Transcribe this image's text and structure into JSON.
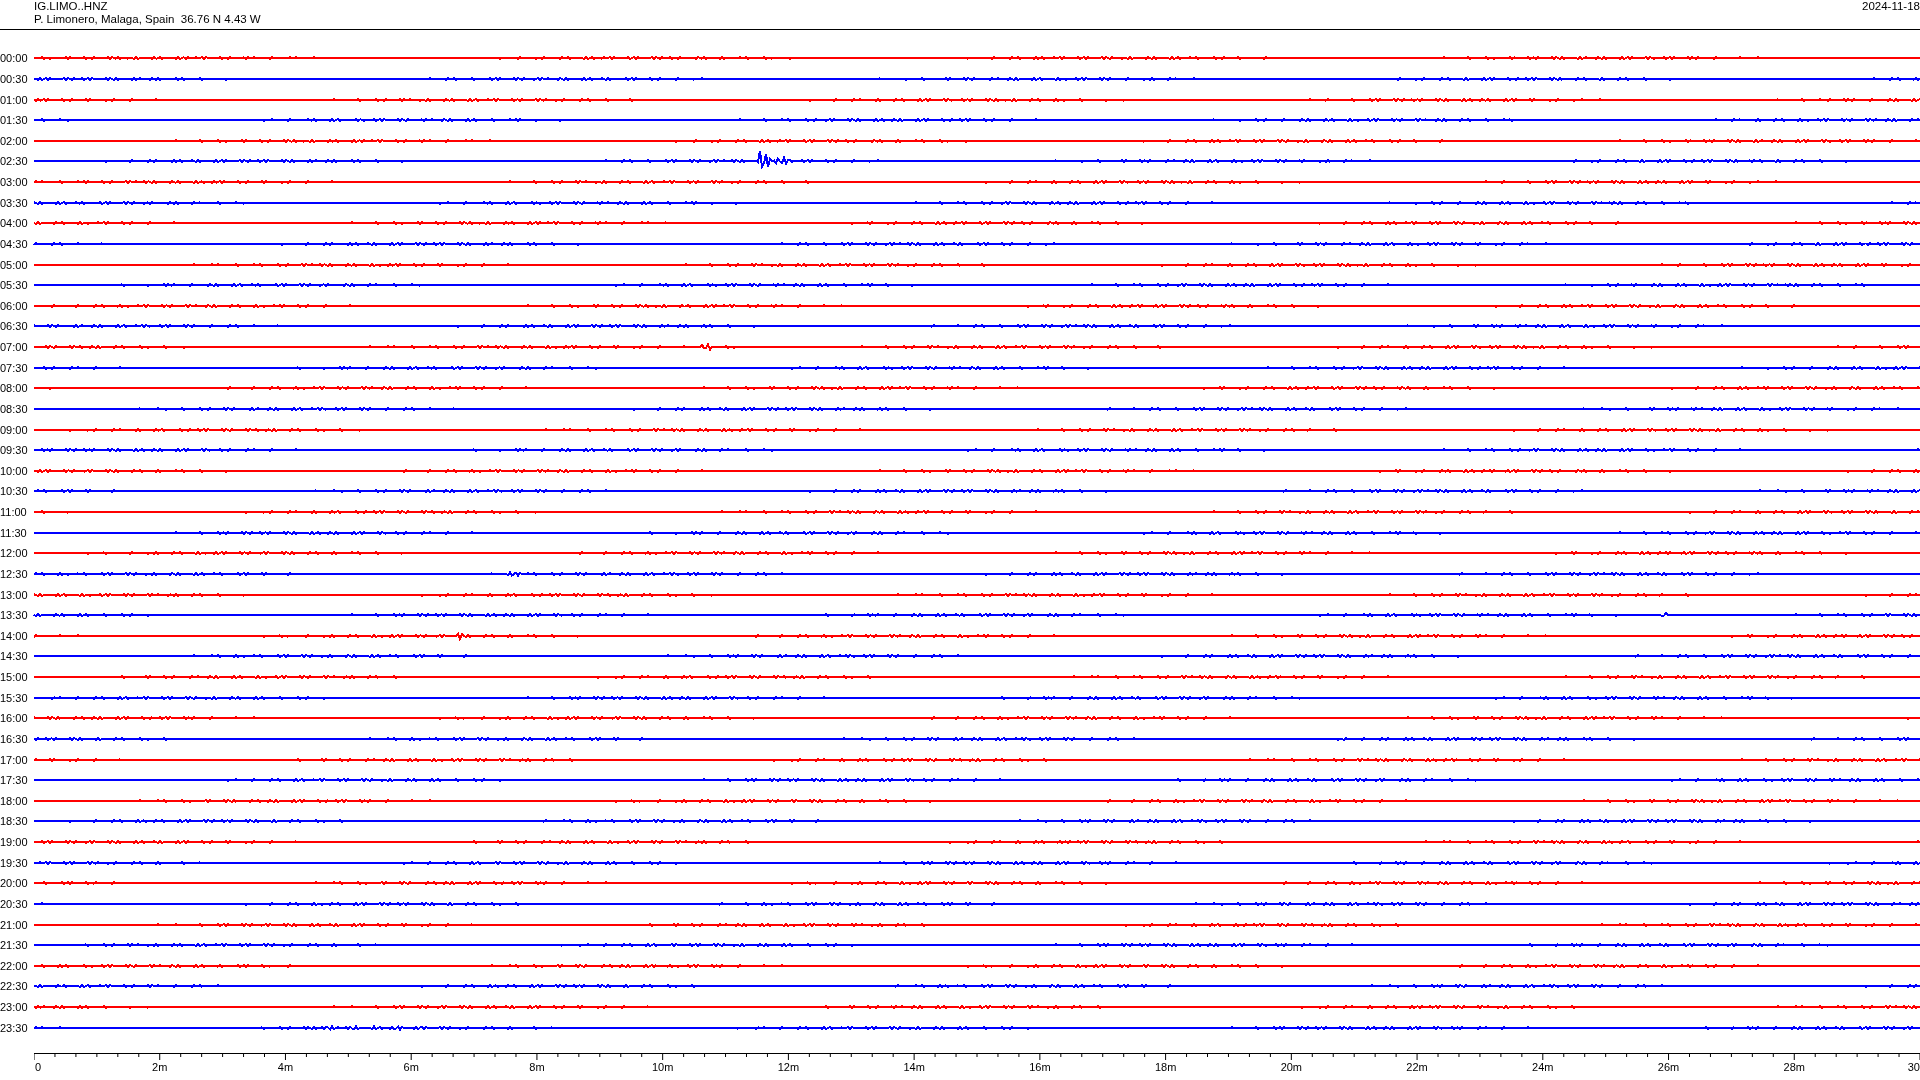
{
  "header": {
    "station": "IG.LIMO..HNZ",
    "location": "P. Limonero, Malaga, Spain  36.76 N 4.43 W",
    "date": "2024-11-18"
  },
  "rows": [
    {
      "time": "00:00",
      "color": "#ff0000"
    },
    {
      "time": "00:30",
      "color": "#0000ff"
    },
    {
      "time": "01:00",
      "color": "#ff0000"
    },
    {
      "time": "01:30",
      "color": "#0000ff"
    },
    {
      "time": "02:00",
      "color": "#ff0000"
    },
    {
      "time": "02:30",
      "color": "#0000ff"
    },
    {
      "time": "03:00",
      "color": "#ff0000"
    },
    {
      "time": "03:30",
      "color": "#0000ff"
    },
    {
      "time": "04:00",
      "color": "#ff0000"
    },
    {
      "time": "04:30",
      "color": "#0000ff"
    },
    {
      "time": "05:00",
      "color": "#ff0000"
    },
    {
      "time": "05:30",
      "color": "#0000ff"
    },
    {
      "time": "06:00",
      "color": "#ff0000"
    },
    {
      "time": "06:30",
      "color": "#0000ff"
    },
    {
      "time": "07:00",
      "color": "#ff0000"
    },
    {
      "time": "07:30",
      "color": "#0000ff"
    },
    {
      "time": "08:00",
      "color": "#ff0000"
    },
    {
      "time": "08:30",
      "color": "#0000ff"
    },
    {
      "time": "09:00",
      "color": "#ff0000"
    },
    {
      "time": "09:30",
      "color": "#0000ff"
    },
    {
      "time": "10:00",
      "color": "#ff0000"
    },
    {
      "time": "10:30",
      "color": "#0000ff"
    },
    {
      "time": "11:00",
      "color": "#ff0000"
    },
    {
      "time": "11:30",
      "color": "#0000ff"
    },
    {
      "time": "12:00",
      "color": "#ff0000"
    },
    {
      "time": "12:30",
      "color": "#0000ff"
    },
    {
      "time": "13:00",
      "color": "#ff0000"
    },
    {
      "time": "13:30",
      "color": "#0000ff"
    },
    {
      "time": "14:00",
      "color": "#ff0000"
    },
    {
      "time": "14:30",
      "color": "#0000ff"
    },
    {
      "time": "15:00",
      "color": "#ff0000"
    },
    {
      "time": "15:30",
      "color": "#0000ff"
    },
    {
      "time": "16:00",
      "color": "#ff0000"
    },
    {
      "time": "16:30",
      "color": "#0000ff"
    },
    {
      "time": "17:00",
      "color": "#ff0000"
    },
    {
      "time": "17:30",
      "color": "#0000ff"
    },
    {
      "time": "18:00",
      "color": "#ff0000"
    },
    {
      "time": "18:30",
      "color": "#0000ff"
    },
    {
      "time": "19:00",
      "color": "#ff0000"
    },
    {
      "time": "19:30",
      "color": "#0000ff"
    },
    {
      "time": "20:00",
      "color": "#ff0000"
    },
    {
      "time": "20:30",
      "color": "#0000ff"
    },
    {
      "time": "21:00",
      "color": "#ff0000"
    },
    {
      "time": "21:30",
      "color": "#0000ff"
    },
    {
      "time": "22:00",
      "color": "#ff0000"
    },
    {
      "time": "22:30",
      "color": "#0000ff"
    },
    {
      "time": "23:00",
      "color": "#ff0000"
    },
    {
      "time": "23:30",
      "color": "#0000ff"
    }
  ],
  "axis": {
    "labels": [
      "0",
      "2m",
      "4m",
      "6m",
      "8m",
      "10m",
      "12m",
      "14m",
      "16m",
      "18m",
      "20m",
      "22m",
      "24m",
      "26m",
      "28m",
      "30"
    ]
  }
}
